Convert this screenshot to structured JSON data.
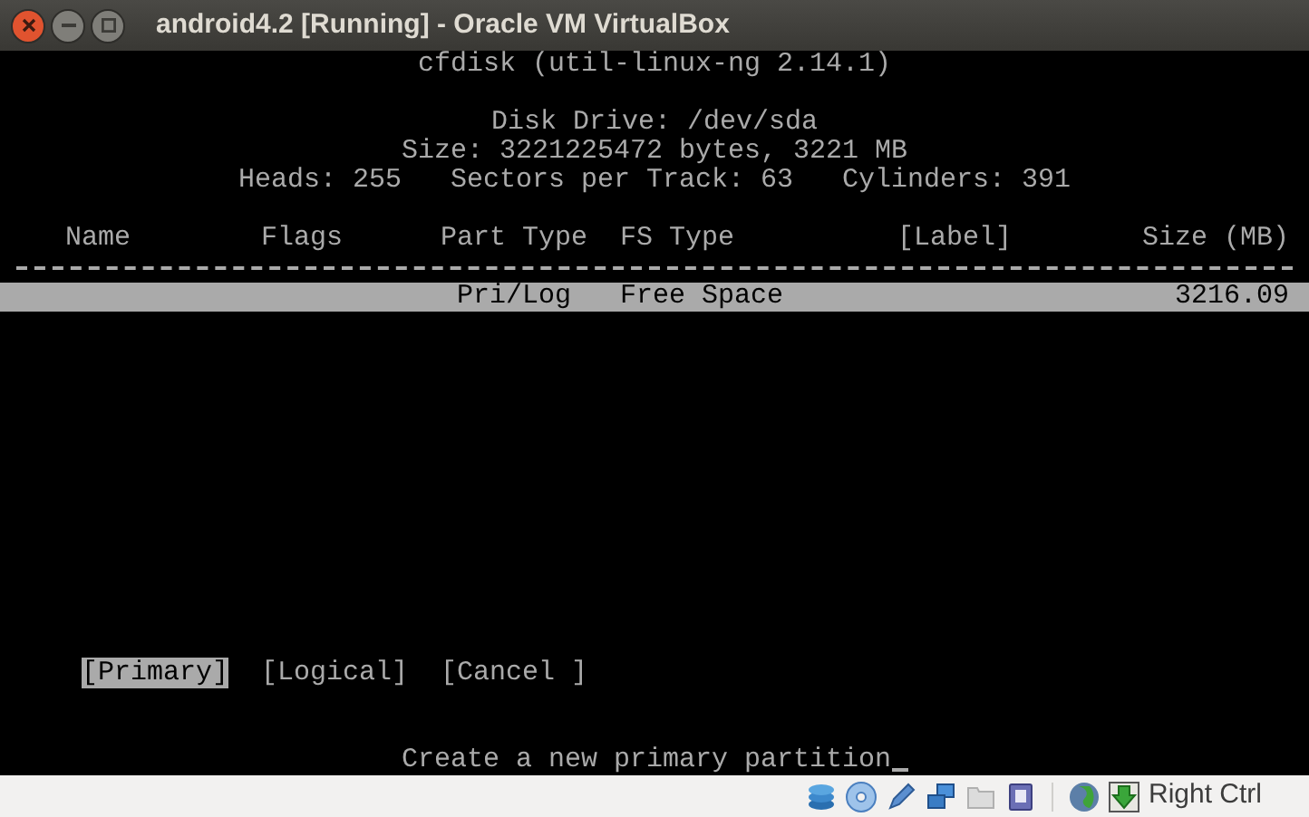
{
  "window": {
    "title": "android4.2 [Running] - Oracle VM VirtualBox"
  },
  "console": {
    "heading": "cfdisk (util-linux-ng 2.14.1)",
    "disk_drive": "Disk Drive: /dev/sda",
    "size": "Size: 3221225472 bytes, 3221 MB",
    "geometry": [
      "Heads: 255",
      "Sectors per Track: 63",
      "Cylinders: 391"
    ],
    "columns": [
      "Name",
      "Flags",
      "Part Type",
      "FS Type",
      "[Label]",
      "Size (MB)"
    ],
    "partitions": [
      {
        "part_type": "Pri/Log",
        "fs_type": "Free Space",
        "size": "3216.09",
        "selected": true
      }
    ],
    "actions": [
      {
        "label": "[Primary]",
        "selected": true
      },
      {
        "label": "[Logical]",
        "selected": false
      },
      {
        "label": "[Cancel ]",
        "selected": false
      }
    ],
    "message": "Create a new primary partition"
  },
  "status_bar": {
    "host_key": "Right Ctrl"
  }
}
